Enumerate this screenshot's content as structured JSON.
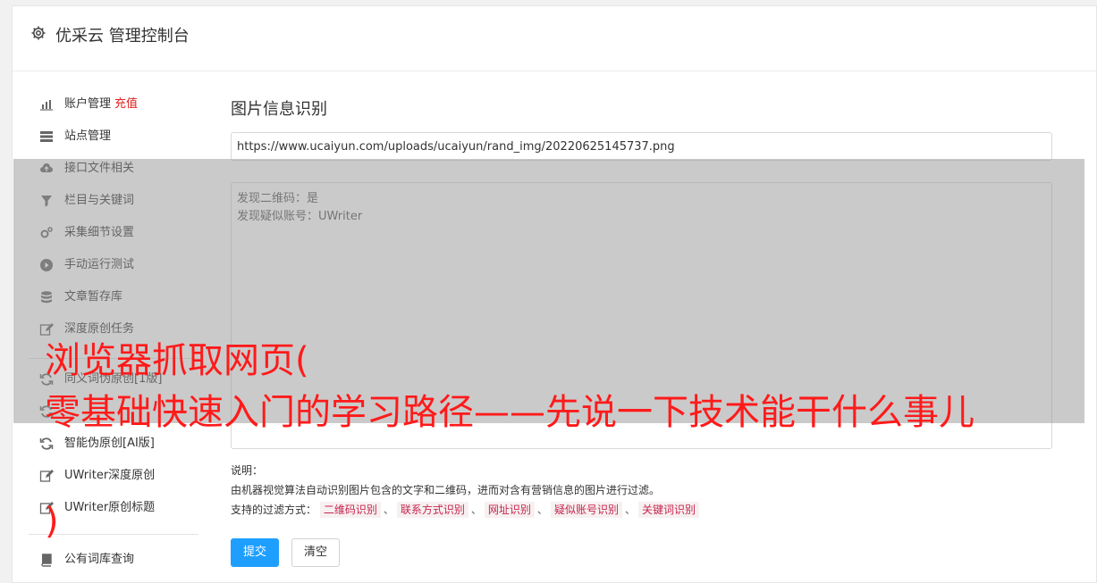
{
  "header": {
    "title": "优采云 管理控制台",
    "icon": "gear-icon"
  },
  "sidebar": {
    "items": [
      {
        "label": "账户管理",
        "badge": "充值",
        "icon": "bar-chart-icon"
      },
      {
        "label": "站点管理",
        "icon": "server-icon"
      },
      {
        "label": "接口文件相关",
        "icon": "cloud-upload-icon"
      },
      {
        "label": "栏目与关键词",
        "icon": "filter-icon"
      },
      {
        "label": "采集细节设置",
        "icon": "cogs-icon"
      },
      {
        "label": "手动运行测试",
        "icon": "play-circle-icon"
      },
      {
        "label": "文章暂存库",
        "icon": "database-icon"
      },
      {
        "label": "深度原创任务",
        "icon": "edit-icon"
      },
      {
        "label": "同义词伪原创[1版]",
        "icon": "refresh-icon"
      },
      {
        "label": "",
        "icon": "refresh-icon"
      },
      {
        "label": "智能伪原创[AI版]",
        "icon": "refresh-icon"
      },
      {
        "label": "UWriter深度原创",
        "icon": "edit-icon"
      },
      {
        "label": "UWriter原创标题",
        "icon": "edit-icon"
      },
      {
        "label": "公有词库查询",
        "icon": "book-icon"
      }
    ]
  },
  "main": {
    "title": "图片信息识别",
    "url_value": "https://www.ucaiyun.com/uploads/ucaiyun/rand_img/20220625145737.png",
    "result_lines": [
      "发现二维码：是",
      "发现疑似账号：UWriter"
    ],
    "notes": {
      "heading": "说明：",
      "description": "由机器视觉算法自动识别图片包含的文字和二维码，进而对含有营销信息的图片进行过滤。",
      "filters_label": "支持的过滤方式：",
      "filters": [
        "二维码识别",
        "联系方式识别",
        "网址识别",
        "疑似账号识别",
        "关键词识别"
      ],
      "separator": "、"
    },
    "submit_label": "提交",
    "clear_label": "清空"
  },
  "overlay": {
    "line1": "浏览器抓取网页(",
    "line2": "零基础快速入门的学习路径——先说一下技术能干什么事儿",
    "line3": ")",
    "text_color": "#ff1a1a"
  },
  "colors": {
    "primary": "#1e9fff",
    "accent": "#e02020",
    "tag_text": "#c7254e"
  }
}
